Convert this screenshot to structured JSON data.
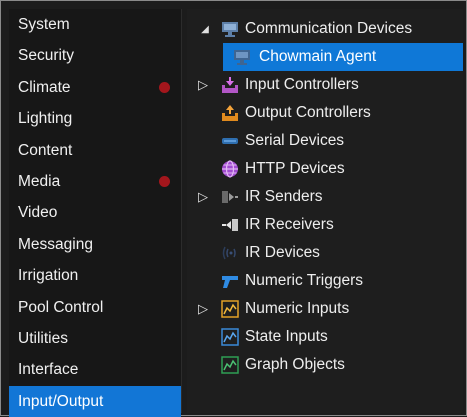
{
  "sidebar": {
    "items": [
      {
        "label": "System",
        "alert": false
      },
      {
        "label": "Security",
        "alert": false
      },
      {
        "label": "Climate",
        "alert": true
      },
      {
        "label": "Lighting",
        "alert": false
      },
      {
        "label": "Content",
        "alert": false
      },
      {
        "label": "Media",
        "alert": true
      },
      {
        "label": "Video",
        "alert": false
      },
      {
        "label": "Messaging",
        "alert": false
      },
      {
        "label": "Irrigation",
        "alert": false
      },
      {
        "label": "Pool Control",
        "alert": false
      },
      {
        "label": "Utilities",
        "alert": false
      },
      {
        "label": "Interface",
        "alert": false
      },
      {
        "label": "Input/Output",
        "alert": false
      }
    ],
    "selected": "Input/Output"
  },
  "tree": {
    "communication_devices": {
      "label": "Communication Devices",
      "expanded": true,
      "icon": "monitor-icon"
    },
    "chowmain_agent": {
      "label": "Chowmain Agent",
      "selected": true,
      "icon": "monitor-icon"
    },
    "input_controllers": {
      "label": "Input Controllers",
      "expandable": true,
      "icon": "input-tray-icon"
    },
    "output_controllers": {
      "label": "Output Controllers",
      "icon": "output-tray-icon"
    },
    "serial_devices": {
      "label": "Serial Devices",
      "icon": "serial-port-icon"
    },
    "http_devices": {
      "label": "HTTP Devices",
      "icon": "globe-icon"
    },
    "ir_senders": {
      "label": "IR Senders",
      "expandable": true,
      "icon": "ir-sender-icon"
    },
    "ir_receivers": {
      "label": "IR Receivers",
      "icon": "ir-receiver-icon"
    },
    "ir_devices": {
      "label": "IR Devices",
      "icon": "ir-waves-icon"
    },
    "numeric_triggers": {
      "label": "Numeric Triggers",
      "icon": "trigger-icon"
    },
    "numeric_inputs": {
      "label": "Numeric Inputs",
      "expandable": true,
      "icon": "graph-orange-icon"
    },
    "state_inputs": {
      "label": "State Inputs",
      "icon": "graph-blue-icon"
    },
    "graph_objects": {
      "label": "Graph Objects",
      "icon": "graph-green-icon"
    }
  },
  "colors": {
    "selection": "#1276d6",
    "alert_dot": "#a3161c",
    "background": "#1e1e1e"
  }
}
